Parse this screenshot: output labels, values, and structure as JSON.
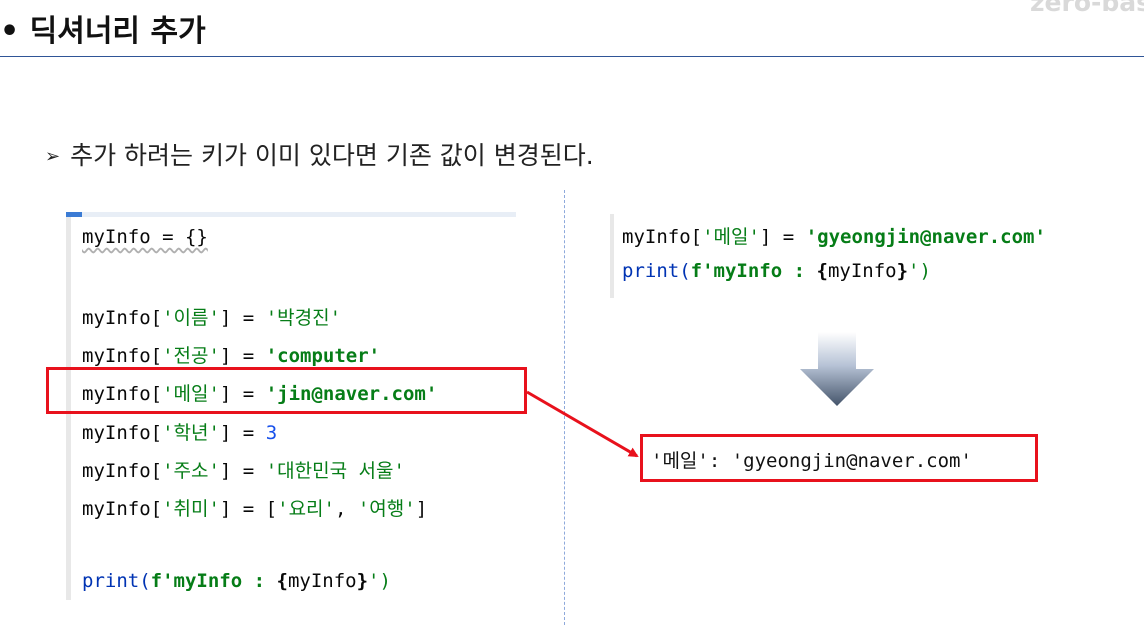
{
  "brand": "zero-bas",
  "title": "• 딕셔너리 추가",
  "subtitle": {
    "bullet": "➢",
    "text": "추가 하려는 키가 이미 있다면 기존 값이 변경된다."
  },
  "left_code": {
    "line1": {
      "a": "myInfo = {}"
    },
    "line2": {
      "a": "myInfo[",
      "b": "'이름'",
      "c": "] = ",
      "d": "'박경진'"
    },
    "line3": {
      "a": "myInfo[",
      "b": "'전공'",
      "c": "] = ",
      "d": "'computer'"
    },
    "line4": {
      "a": "myInfo[",
      "b": "'메일'",
      "c": "] = ",
      "d": "'jin@naver.com'"
    },
    "line5": {
      "a": "myInfo[",
      "b": "'학년'",
      "c": "] = ",
      "d": "3"
    },
    "line6": {
      "a": "myInfo[",
      "b": "'주소'",
      "c": "] = ",
      "d": "'대한민국 서울'"
    },
    "line7": {
      "a": "myInfo[",
      "b": "'취미'",
      "c": "] = [",
      "d": "'요리'",
      "e": ", ",
      "f": "'여행'",
      "g": "]"
    },
    "line8": {
      "a": "print(",
      "b": "f'myInfo : ",
      "c": "{",
      "d": "myInfo",
      "e": "}",
      "f": "')"
    }
  },
  "right_code": {
    "line1": {
      "a": "myInfo[",
      "b": "'메일'",
      "c": "] = ",
      "d": "'gyeongjin@naver.com'"
    },
    "line2": {
      "a": "print(",
      "b": "f'myInfo : ",
      "c": "{",
      "d": "myInfo",
      "e": "}",
      "f": "')"
    }
  },
  "result": "'메일': 'gyeongjin@naver.com'",
  "colors": {
    "highlight_border": "#e8111c",
    "string": "#067d17",
    "number": "#1750eb",
    "rule": "#2f5597"
  },
  "icons": {
    "arrow": "down-arrow-icon",
    "connector": "connector-arrow-icon"
  }
}
